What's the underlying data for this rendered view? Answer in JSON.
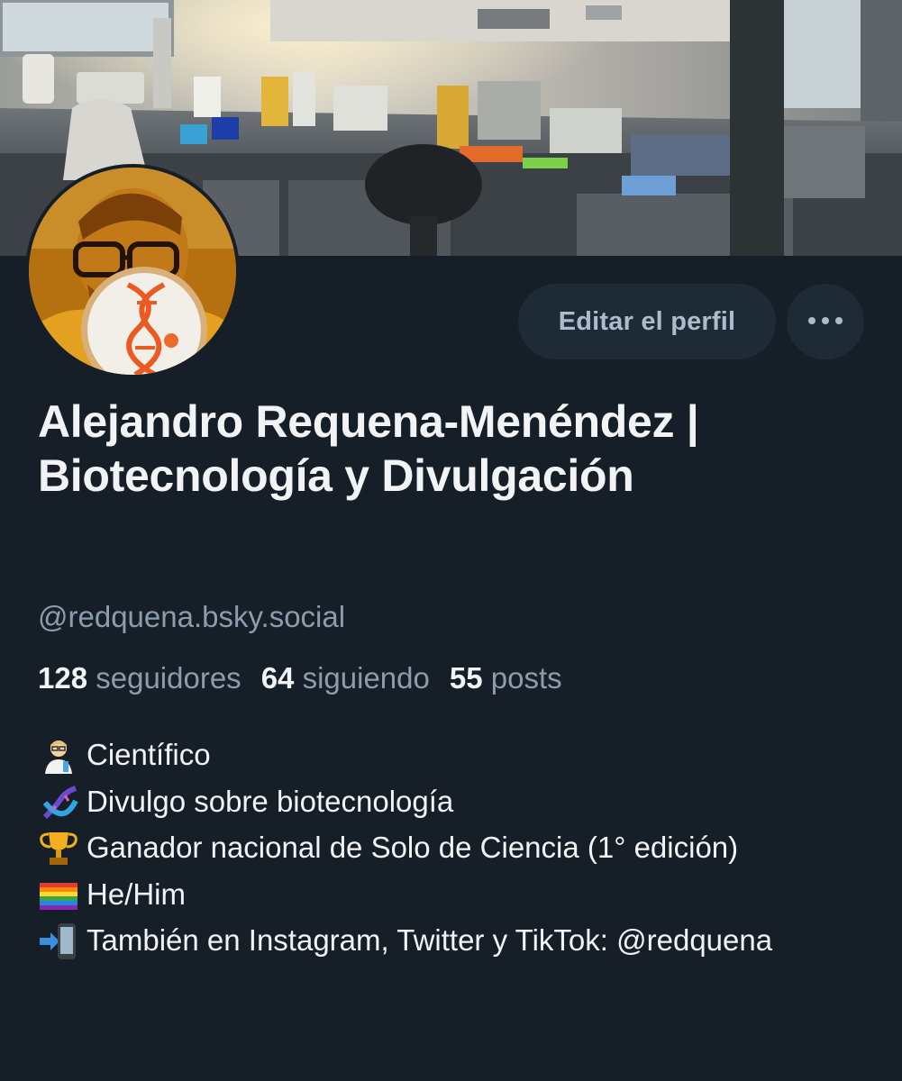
{
  "profile": {
    "display_name": "Alejandro Requena-Menéndez | Biotecnología y Divulgación",
    "handle": "@redquena.bsky.social",
    "edit_button_label": "Editar el perfil",
    "more_button_icon": "ellipsis-icon"
  },
  "stats": {
    "followers_count": "128",
    "followers_label": "seguidores",
    "following_count": "64",
    "following_label": "siguiendo",
    "posts_count": "55",
    "posts_label": "posts"
  },
  "bio": {
    "lines": [
      {
        "icon": "scientist-emoji",
        "text": "Científico"
      },
      {
        "icon": "dna-emoji",
        "text": "Divulgo sobre biotecnología"
      },
      {
        "icon": "trophy-emoji",
        "text": "Ganador nacional de Solo de Ciencia (1° edición)"
      },
      {
        "icon": "rainbow-flag-emoji",
        "text": "He/Him"
      },
      {
        "icon": "mobile-arrow-emoji",
        "text": "También en Instagram, Twitter y TikTok: @redquena"
      }
    ]
  },
  "colors": {
    "background": "#161e27",
    "button_background": "#1e2a36",
    "secondary_text": "#8d9cac",
    "primary_text": "#f1f3f5"
  }
}
